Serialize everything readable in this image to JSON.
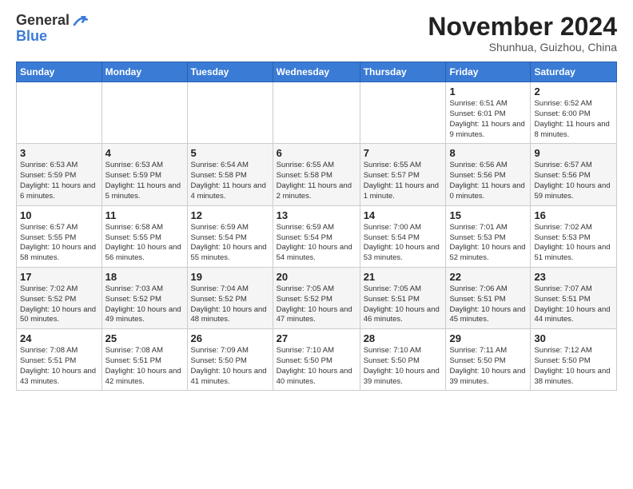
{
  "header": {
    "logo_general": "General",
    "logo_blue": "Blue",
    "month_title": "November 2024",
    "location": "Shunhua, Guizhou, China"
  },
  "weekdays": [
    "Sunday",
    "Monday",
    "Tuesday",
    "Wednesday",
    "Thursday",
    "Friday",
    "Saturday"
  ],
  "weeks": [
    [
      {
        "day": "",
        "info": ""
      },
      {
        "day": "",
        "info": ""
      },
      {
        "day": "",
        "info": ""
      },
      {
        "day": "",
        "info": ""
      },
      {
        "day": "",
        "info": ""
      },
      {
        "day": "1",
        "info": "Sunrise: 6:51 AM\nSunset: 6:01 PM\nDaylight: 11 hours and 9 minutes."
      },
      {
        "day": "2",
        "info": "Sunrise: 6:52 AM\nSunset: 6:00 PM\nDaylight: 11 hours and 8 minutes."
      }
    ],
    [
      {
        "day": "3",
        "info": "Sunrise: 6:53 AM\nSunset: 5:59 PM\nDaylight: 11 hours and 6 minutes."
      },
      {
        "day": "4",
        "info": "Sunrise: 6:53 AM\nSunset: 5:59 PM\nDaylight: 11 hours and 5 minutes."
      },
      {
        "day": "5",
        "info": "Sunrise: 6:54 AM\nSunset: 5:58 PM\nDaylight: 11 hours and 4 minutes."
      },
      {
        "day": "6",
        "info": "Sunrise: 6:55 AM\nSunset: 5:58 PM\nDaylight: 11 hours and 2 minutes."
      },
      {
        "day": "7",
        "info": "Sunrise: 6:55 AM\nSunset: 5:57 PM\nDaylight: 11 hours and 1 minute."
      },
      {
        "day": "8",
        "info": "Sunrise: 6:56 AM\nSunset: 5:56 PM\nDaylight: 11 hours and 0 minutes."
      },
      {
        "day": "9",
        "info": "Sunrise: 6:57 AM\nSunset: 5:56 PM\nDaylight: 10 hours and 59 minutes."
      }
    ],
    [
      {
        "day": "10",
        "info": "Sunrise: 6:57 AM\nSunset: 5:55 PM\nDaylight: 10 hours and 58 minutes."
      },
      {
        "day": "11",
        "info": "Sunrise: 6:58 AM\nSunset: 5:55 PM\nDaylight: 10 hours and 56 minutes."
      },
      {
        "day": "12",
        "info": "Sunrise: 6:59 AM\nSunset: 5:54 PM\nDaylight: 10 hours and 55 minutes."
      },
      {
        "day": "13",
        "info": "Sunrise: 6:59 AM\nSunset: 5:54 PM\nDaylight: 10 hours and 54 minutes."
      },
      {
        "day": "14",
        "info": "Sunrise: 7:00 AM\nSunset: 5:54 PM\nDaylight: 10 hours and 53 minutes."
      },
      {
        "day": "15",
        "info": "Sunrise: 7:01 AM\nSunset: 5:53 PM\nDaylight: 10 hours and 52 minutes."
      },
      {
        "day": "16",
        "info": "Sunrise: 7:02 AM\nSunset: 5:53 PM\nDaylight: 10 hours and 51 minutes."
      }
    ],
    [
      {
        "day": "17",
        "info": "Sunrise: 7:02 AM\nSunset: 5:52 PM\nDaylight: 10 hours and 50 minutes."
      },
      {
        "day": "18",
        "info": "Sunrise: 7:03 AM\nSunset: 5:52 PM\nDaylight: 10 hours and 49 minutes."
      },
      {
        "day": "19",
        "info": "Sunrise: 7:04 AM\nSunset: 5:52 PM\nDaylight: 10 hours and 48 minutes."
      },
      {
        "day": "20",
        "info": "Sunrise: 7:05 AM\nSunset: 5:52 PM\nDaylight: 10 hours and 47 minutes."
      },
      {
        "day": "21",
        "info": "Sunrise: 7:05 AM\nSunset: 5:51 PM\nDaylight: 10 hours and 46 minutes."
      },
      {
        "day": "22",
        "info": "Sunrise: 7:06 AM\nSunset: 5:51 PM\nDaylight: 10 hours and 45 minutes."
      },
      {
        "day": "23",
        "info": "Sunrise: 7:07 AM\nSunset: 5:51 PM\nDaylight: 10 hours and 44 minutes."
      }
    ],
    [
      {
        "day": "24",
        "info": "Sunrise: 7:08 AM\nSunset: 5:51 PM\nDaylight: 10 hours and 43 minutes."
      },
      {
        "day": "25",
        "info": "Sunrise: 7:08 AM\nSunset: 5:51 PM\nDaylight: 10 hours and 42 minutes."
      },
      {
        "day": "26",
        "info": "Sunrise: 7:09 AM\nSunset: 5:50 PM\nDaylight: 10 hours and 41 minutes."
      },
      {
        "day": "27",
        "info": "Sunrise: 7:10 AM\nSunset: 5:50 PM\nDaylight: 10 hours and 40 minutes."
      },
      {
        "day": "28",
        "info": "Sunrise: 7:10 AM\nSunset: 5:50 PM\nDaylight: 10 hours and 39 minutes."
      },
      {
        "day": "29",
        "info": "Sunrise: 7:11 AM\nSunset: 5:50 PM\nDaylight: 10 hours and 39 minutes."
      },
      {
        "day": "30",
        "info": "Sunrise: 7:12 AM\nSunset: 5:50 PM\nDaylight: 10 hours and 38 minutes."
      }
    ]
  ]
}
